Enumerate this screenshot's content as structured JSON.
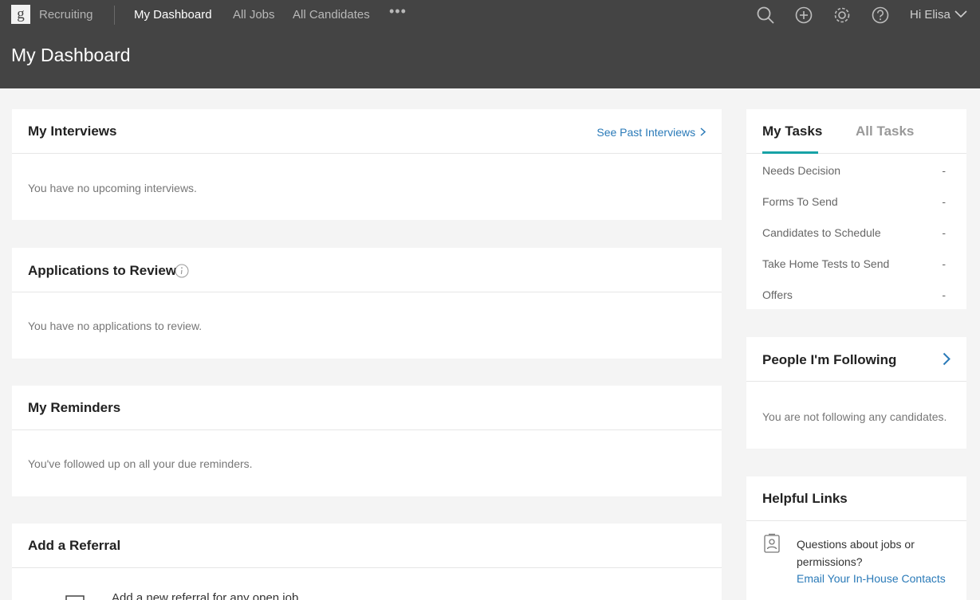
{
  "topbar": {
    "logo_letter": "g",
    "brand": "Recruiting",
    "nav": [
      "My Dashboard",
      "All Jobs",
      "All Candidates"
    ],
    "more": "•••",
    "icons": [
      "search-icon",
      "plus-circle-icon",
      "gear-icon",
      "help-icon"
    ],
    "user_greeting": "Hi Elisa",
    "page_title": "My Dashboard"
  },
  "interviews": {
    "title": "My Interviews",
    "link": "See Past Interviews",
    "empty": "You have no upcoming interviews."
  },
  "applications": {
    "title": "Applications to Review",
    "empty": "You have no applications to review."
  },
  "reminders": {
    "title": "My Reminders",
    "empty": "You've followed up on all your due reminders."
  },
  "referral": {
    "title": "Add a Referral",
    "text": "Add a new referral for any open job"
  },
  "tasks": {
    "tabs": [
      "My Tasks",
      "All Tasks"
    ],
    "rows": [
      {
        "label": "Needs Decision",
        "value": "-"
      },
      {
        "label": "Forms To Send",
        "value": "-"
      },
      {
        "label": "Candidates to Schedule",
        "value": "-"
      },
      {
        "label": "Take Home Tests to Send",
        "value": "-"
      },
      {
        "label": "Offers",
        "value": "-"
      }
    ]
  },
  "following": {
    "title": "People I'm Following",
    "empty": "You are not following any candidates."
  },
  "helpful": {
    "title": "Helpful Links",
    "line1": "Questions about jobs or",
    "line2": "permissions?",
    "link": "Email Your In-House Contacts"
  },
  "colors": {
    "topbar": "#444444",
    "accent": "#17a2a6",
    "link": "#2a7ab8"
  }
}
